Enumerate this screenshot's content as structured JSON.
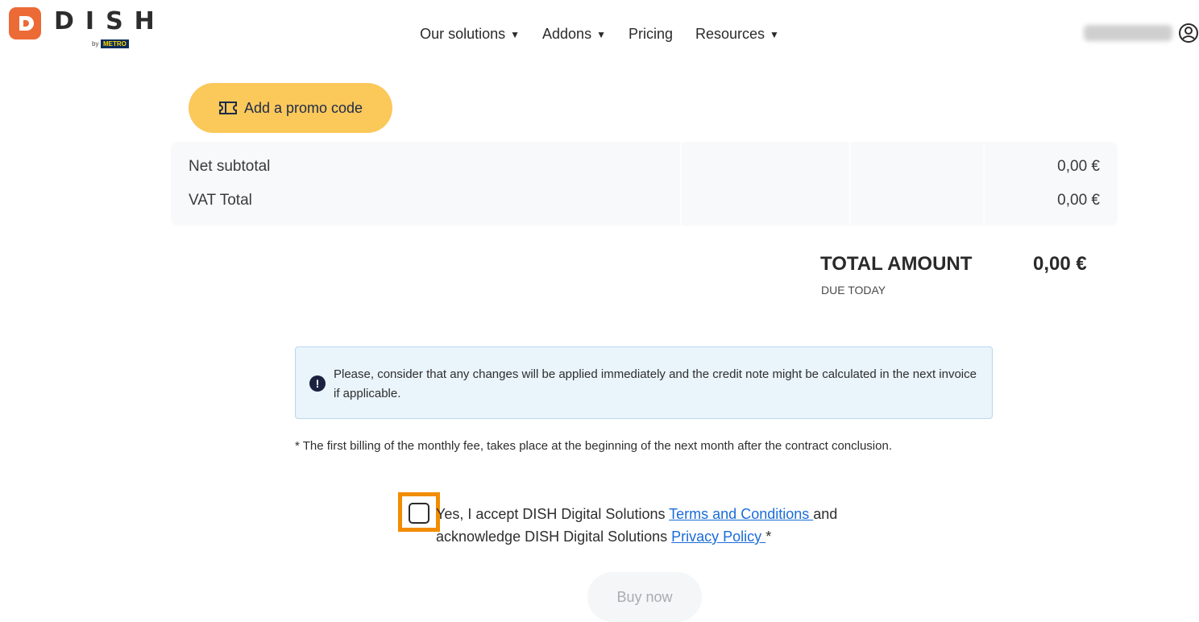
{
  "brand": {
    "name": "DISH",
    "by": "by",
    "metro": "METRO"
  },
  "nav": {
    "items": [
      {
        "label": "Our solutions",
        "has_caret": true
      },
      {
        "label": "Addons",
        "has_caret": true
      },
      {
        "label": "Pricing",
        "has_caret": false
      },
      {
        "label": "Resources",
        "has_caret": true
      }
    ],
    "caret": "▼"
  },
  "icons": {
    "user": "user-circle-icon",
    "promo": "ticket-icon",
    "info": "exclamation-circle-icon"
  },
  "promo": {
    "label": "Add a promo code"
  },
  "totals": {
    "rows": [
      {
        "label": "Net subtotal",
        "value": "0,00 €"
      },
      {
        "label": "VAT Total",
        "value": "0,00 €"
      }
    ],
    "total_label": "TOTAL AMOUNT",
    "total_value": "0,00 €",
    "due": "DUE TODAY"
  },
  "info": {
    "icon_glyph": "!",
    "text": "Please, consider that any changes will be applied immediately and the credit note might be calculated in the next invoice if applicable."
  },
  "billing_note": "* The first billing of the monthly fee, takes place at the beginning of the next month after the contract conclusion.",
  "accept": {
    "text1": "Yes, I accept DISH Digital Solutions ",
    "terms_link": "Terms and Conditions ",
    "text2": "and acknowledge DISH Digital Solutions ",
    "privacy_link": "Privacy Policy ",
    "text3": "*"
  },
  "buy_button": {
    "label": "Buy now"
  },
  "colors": {
    "accent": "#f28c00",
    "promo": "#fbc85a",
    "link": "#1a6cd9",
    "logo": "#ec6a35"
  }
}
